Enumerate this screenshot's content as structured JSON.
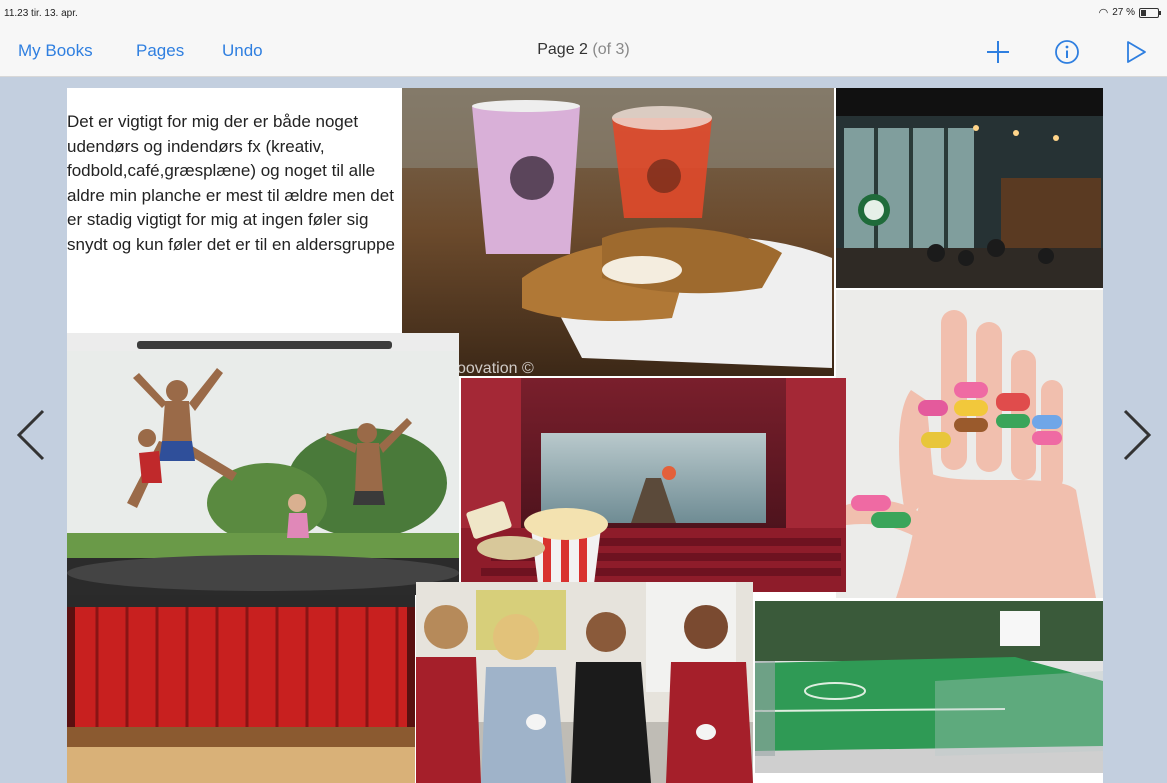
{
  "status": {
    "time": "11.23  tir. 13. apr.",
    "battery": "27 %"
  },
  "toolbar": {
    "my_books": "My Books",
    "pages": "Pages",
    "undo": "Undo",
    "title_main": "Page 2",
    "title_sub": "(of 3)"
  },
  "page": {
    "text": "Det er vigtigt for mig der er både noget udendørs og indendørs fx (kreativ, fodbold,café,græsplæne) og noget til alle aldre min planche er mest til ældre men det er stadig vigtigt for mig at ingen føler sig snydt og kun føler det er til en aldersgruppe",
    "watermark": "oovation ©"
  },
  "colors": {
    "accent": "#2f7fe0",
    "background": "#c3cfdf"
  }
}
